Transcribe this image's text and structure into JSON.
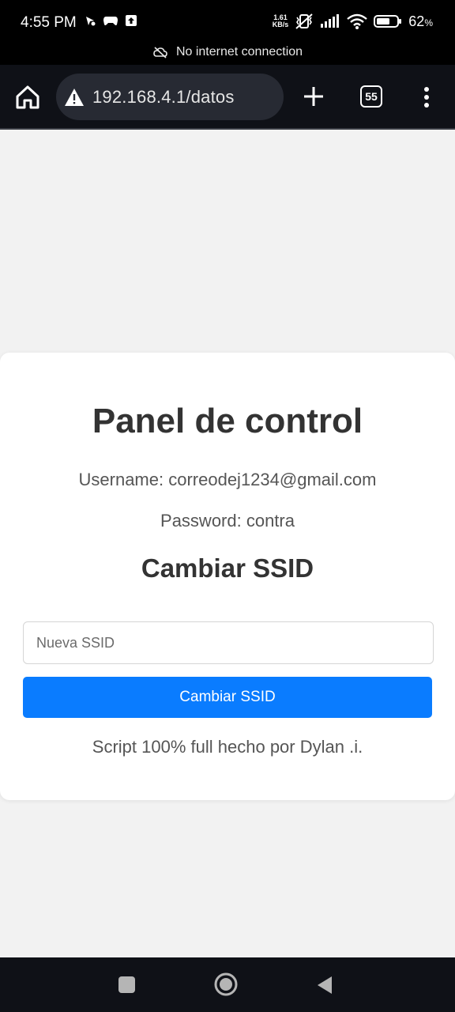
{
  "status_bar": {
    "time": "4:55 PM",
    "net_speed_value": "1.61",
    "net_speed_unit": "KB/s",
    "battery_percent": "62",
    "battery_unit": "%"
  },
  "offline_banner": {
    "text": "No internet connection"
  },
  "browser": {
    "url": "192.168.4.1/datos",
    "tab_count": "55"
  },
  "page": {
    "title": "Panel de control",
    "username_line": "Username: correodej1234@gmail.com",
    "password_line": "Password: contra",
    "subtitle": "Cambiar SSID",
    "ssid_placeholder": "Nueva SSID",
    "ssid_button": "Cambiar SSID",
    "footer": "Script 100% full hecho por Dylan .i."
  },
  "colors": {
    "primary_button": "#0a7cff",
    "page_background": "#f2f2f2",
    "toolbar_background": "#0f1117"
  }
}
